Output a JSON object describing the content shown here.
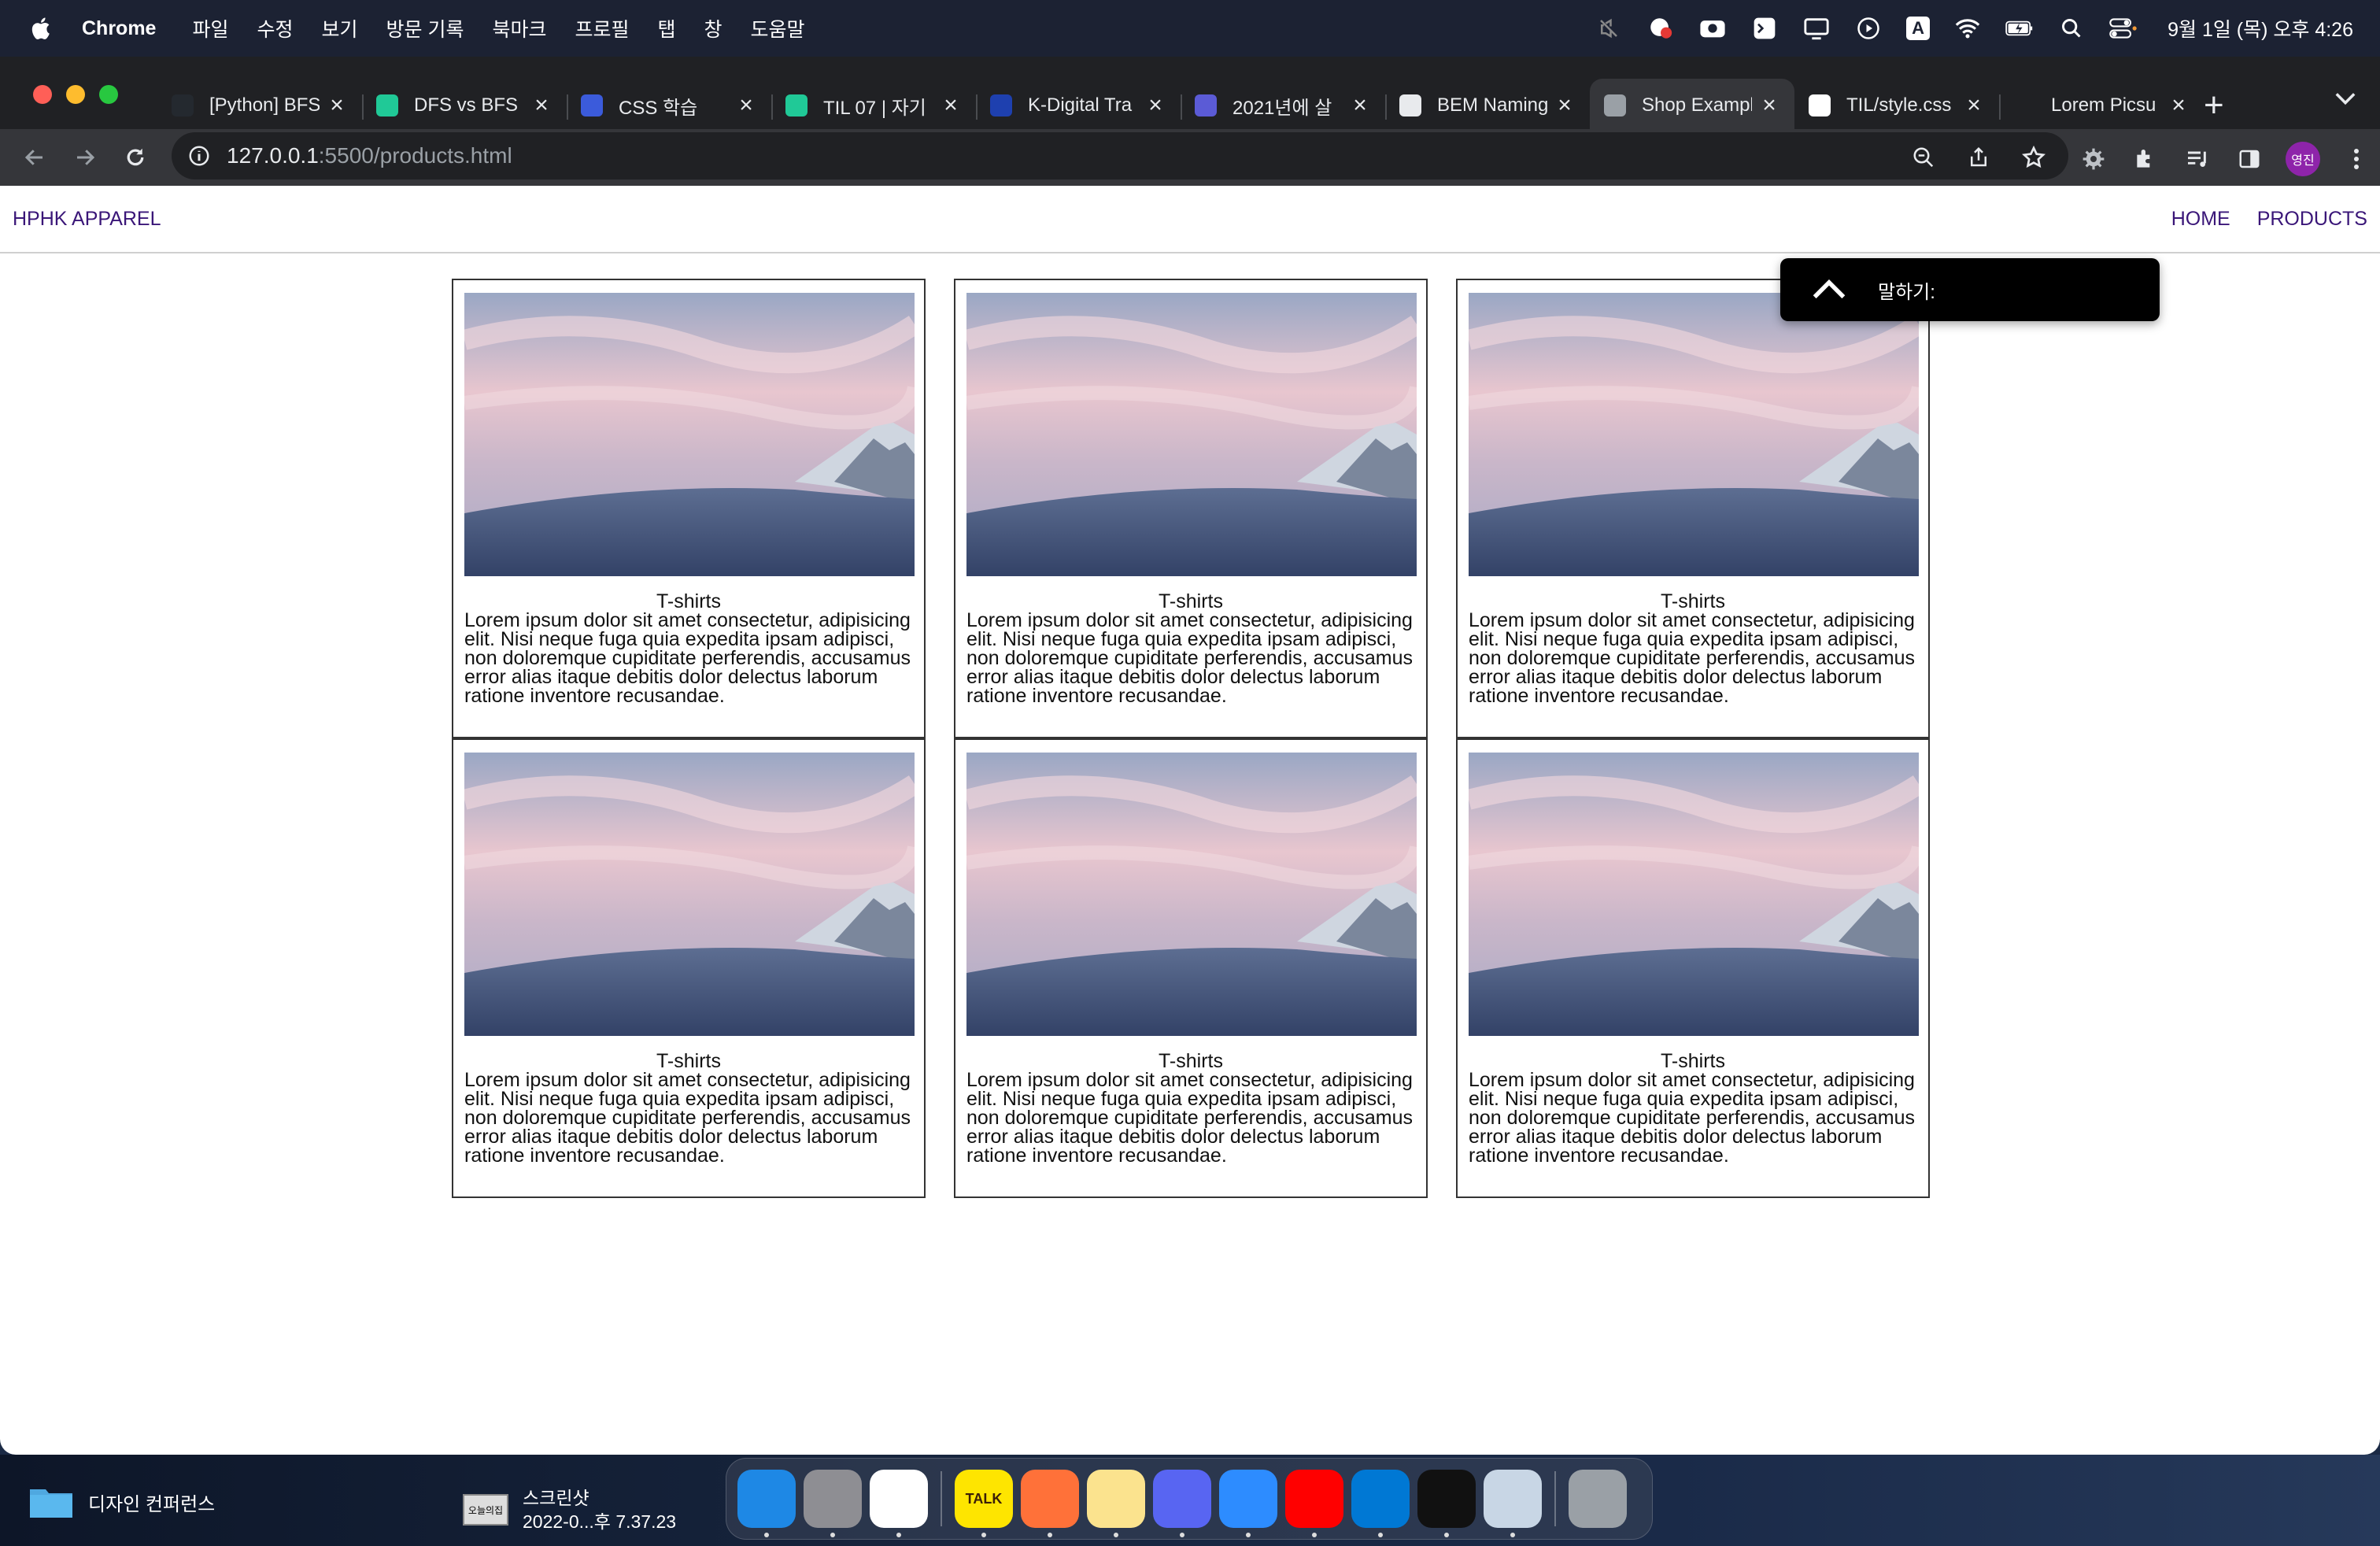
{
  "menubar": {
    "app": "Chrome",
    "menus": [
      "파일",
      "수정",
      "보기",
      "방문 기록",
      "북마크",
      "프로필",
      "탭",
      "창",
      "도움말"
    ],
    "clock": "9월 1일 (목) 오후 4:26",
    "input_indicator": "A"
  },
  "browser": {
    "tabs": [
      {
        "title": "[Python] BFS",
        "favicon": "github-dark-icon",
        "color": "#24292f"
      },
      {
        "title": "DFS vs BFS",
        "favicon": "velog-icon",
        "color": "#20c997"
      },
      {
        "title": "CSS 학습",
        "favicon": "cursor-icon",
        "color": "#3b5bdb"
      },
      {
        "title": "TIL 07 | 자기",
        "favicon": "velog-icon",
        "color": "#20c997"
      },
      {
        "title": "K-Digital Tra",
        "favicon": "m-icon",
        "color": "#1e40af"
      },
      {
        "title": "2021년에 살",
        "favicon": "ui-icon",
        "color": "#5b5bd6"
      },
      {
        "title": "BEM Naming",
        "favicon": "bem-icon",
        "color": "#e8eaed"
      },
      {
        "title": "Shop Exampl",
        "favicon": "globe-icon",
        "color": "#9aa0a6",
        "active": true
      },
      {
        "title": "TIL/style.css",
        "favicon": "github-icon",
        "color": "#ffffff"
      },
      {
        "title": "Lorem Picsu",
        "favicon": "blank-icon",
        "color": "#202124"
      }
    ],
    "url_host": "127.0.0.1",
    "url_rest": ":5500/products.html",
    "profile": "영진"
  },
  "site": {
    "brand": "HPHK APPAREL",
    "nav": [
      "HOME",
      "PRODUCTS"
    ],
    "products": [
      {
        "title": "T-shirts",
        "desc": "Lorem ipsum dolor sit amet consectetur, adipisicing elit. Nisi neque fuga quia expedita ipsam adipisci, non doloremque cupiditate perferendis, accusamus error alias itaque debitis dolor delectus laborum ratione inventore recusandae."
      },
      {
        "title": "T-shirts",
        "desc": "Lorem ipsum dolor sit amet consectetur, adipisicing elit. Nisi neque fuga quia expedita ipsam adipisci, non doloremque cupiditate perferendis, accusamus error alias itaque debitis dolor delectus laborum ratione inventore recusandae."
      },
      {
        "title": "T-shirts",
        "desc": "Lorem ipsum dolor sit amet consectetur, adipisicing elit. Nisi neque fuga quia expedita ipsam adipisci, non doloremque cupiditate perferendis, accusamus error alias itaque debitis dolor delectus laborum ratione inventore recusandae."
      },
      {
        "title": "T-shirts",
        "desc": "Lorem ipsum dolor sit amet consectetur, adipisicing elit. Nisi neque fuga quia expedita ipsam adipisci, non doloremque cupiditate perferendis, accusamus error alias itaque debitis dolor delectus laborum ratione inventore recusandae."
      },
      {
        "title": "T-shirts",
        "desc": "Lorem ipsum dolor sit amet consectetur, adipisicing elit. Nisi neque fuga quia expedita ipsam adipisci, non doloremque cupiditate perferendis, accusamus error alias itaque debitis dolor delectus laborum ratione inventore recusandae."
      },
      {
        "title": "T-shirts",
        "desc": "Lorem ipsum dolor sit amet consectetur, adipisicing elit. Nisi neque fuga quia expedita ipsam adipisci, non doloremque cupiditate perferendis, accusamus error alias itaque debitis dolor delectus laborum ratione inventore recusandae."
      }
    ]
  },
  "tts_popup": {
    "label": "말하기:"
  },
  "desktop": {
    "folder": "디자인 컨퍼런스",
    "screenshot_line1": "스크린샷",
    "screenshot_line2": "2022-0...후 7.37.23",
    "screenshot_thumb": "오늘의집"
  },
  "dock": {
    "apps": [
      {
        "name": "finder",
        "color": "#1e88e5"
      },
      {
        "name": "system-preferences",
        "color": "#8e8e93"
      },
      {
        "name": "chrome",
        "color": "#ffffff"
      },
      {
        "name": "kakaotalk",
        "color": "#fee500",
        "label": "TALK"
      },
      {
        "name": "firefox",
        "color": "#ff7139"
      },
      {
        "name": "notes",
        "color": "#fbe38e"
      },
      {
        "name": "discord",
        "color": "#5865f2"
      },
      {
        "name": "zoom",
        "color": "#2d8cff"
      },
      {
        "name": "youtube-music",
        "color": "#ff0000"
      },
      {
        "name": "vscode",
        "color": "#0078d4"
      },
      {
        "name": "terminal",
        "color": "#111111"
      },
      {
        "name": "preview",
        "color": "#c8d6e5"
      },
      {
        "name": "trash",
        "color": "#9aa0a6"
      }
    ]
  }
}
